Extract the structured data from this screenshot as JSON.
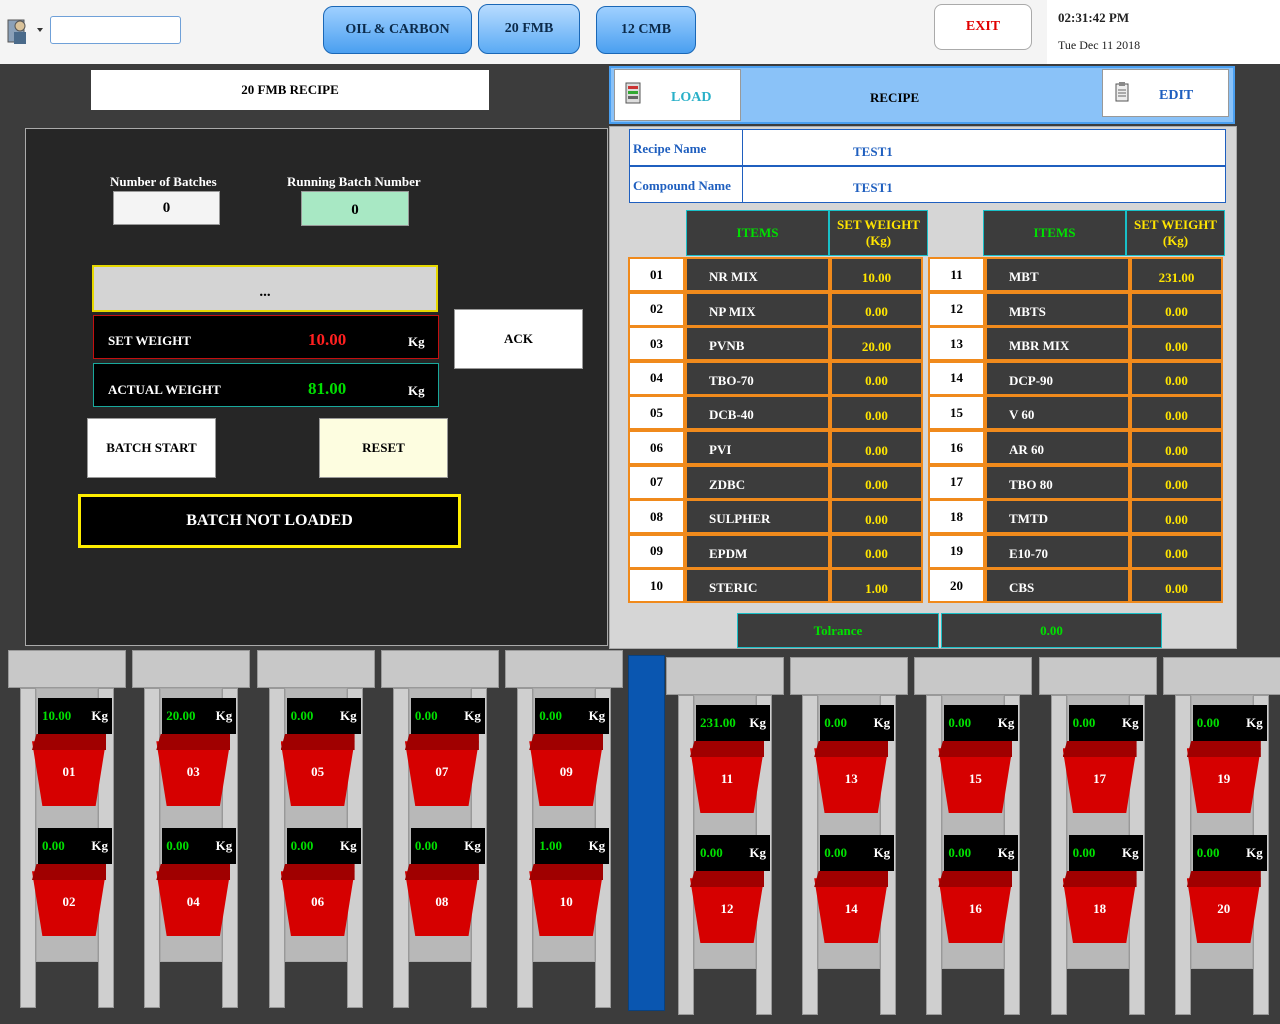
{
  "header": {
    "tabs": [
      {
        "label": "OIL & CARBON"
      },
      {
        "label": "20 FMB"
      },
      {
        "label": "12 CMB"
      }
    ],
    "exit_label": "EXIT",
    "time": "02:31:42 PM",
    "date": "Tue Dec 11 2018",
    "search_value": ""
  },
  "left": {
    "title": "20 FMB RECIPE",
    "batches_label": "Number of Batches",
    "batches_value": "0",
    "running_label": "Running Batch Number",
    "running_value": "0",
    "item_display": "...",
    "set_weight_label": "SET WEIGHT",
    "set_weight_value": "10.00",
    "actual_weight_label": "ACTUAL WEIGHT",
    "actual_weight_value": "81.00",
    "unit": "Kg",
    "ack_label": "ACK",
    "batch_start_label": "BATCH START",
    "reset_label": "RESET",
    "status": "BATCH NOT LOADED"
  },
  "recipe": {
    "load_label": "LOAD",
    "title": "RECIPE",
    "edit_label": "EDIT",
    "recipe_name_label": "Recipe Name",
    "recipe_name": "TEST1",
    "compound_name_label": "Compound Name",
    "compound_name": "TEST1",
    "items_header": "ITEMS",
    "setweight_header": "SET WEIGHT (Kg)",
    "rows_left": [
      {
        "no": "01",
        "item": "NR MIX",
        "weight": "10.00"
      },
      {
        "no": "02",
        "item": "NP MIX",
        "weight": "0.00"
      },
      {
        "no": "03",
        "item": "PVNB",
        "weight": "20.00"
      },
      {
        "no": "04",
        "item": "TBO-70",
        "weight": "0.00"
      },
      {
        "no": "05",
        "item": "DCB-40",
        "weight": "0.00"
      },
      {
        "no": "06",
        "item": "PVI",
        "weight": "0.00"
      },
      {
        "no": "07",
        "item": "ZDBC",
        "weight": "0.00"
      },
      {
        "no": "08",
        "item": "SULPHER",
        "weight": "0.00"
      },
      {
        "no": "09",
        "item": "EPDM",
        "weight": "0.00"
      },
      {
        "no": "10",
        "item": "STERIC",
        "weight": "1.00"
      }
    ],
    "rows_right": [
      {
        "no": "11",
        "item": "MBT",
        "weight": "231.00"
      },
      {
        "no": "12",
        "item": "MBTS",
        "weight": "0.00"
      },
      {
        "no": "13",
        "item": "MBR MIX",
        "weight": "0.00"
      },
      {
        "no": "14",
        "item": "DCP-90",
        "weight": "0.00"
      },
      {
        "no": "15",
        "item": "V 60",
        "weight": "0.00"
      },
      {
        "no": "16",
        "item": "AR 60",
        "weight": "0.00"
      },
      {
        "no": "17",
        "item": "TBO 80",
        "weight": "0.00"
      },
      {
        "no": "18",
        "item": "TMTD",
        "weight": "0.00"
      },
      {
        "no": "19",
        "item": "E10-70",
        "weight": "0.00"
      },
      {
        "no": "20",
        "item": "CBS",
        "weight": "0.00"
      }
    ],
    "tolerance_label": "Tolrance",
    "tolerance_value": "0.00"
  },
  "hoppers": {
    "unit": "Kg",
    "left_columns": [
      {
        "top": {
          "id": "01",
          "weight": "10.00"
        },
        "bottom": {
          "id": "02",
          "weight": "0.00"
        }
      },
      {
        "top": {
          "id": "03",
          "weight": "20.00"
        },
        "bottom": {
          "id": "04",
          "weight": "0.00"
        }
      },
      {
        "top": {
          "id": "05",
          "weight": "0.00"
        },
        "bottom": {
          "id": "06",
          "weight": "0.00"
        }
      },
      {
        "top": {
          "id": "07",
          "weight": "0.00"
        },
        "bottom": {
          "id": "08",
          "weight": "0.00"
        }
      },
      {
        "top": {
          "id": "09",
          "weight": "0.00"
        },
        "bottom": {
          "id": "10",
          "weight": "1.00"
        }
      }
    ],
    "right_columns": [
      {
        "top": {
          "id": "11",
          "weight": "231.00"
        },
        "bottom": {
          "id": "12",
          "weight": "0.00"
        }
      },
      {
        "top": {
          "id": "13",
          "weight": "0.00"
        },
        "bottom": {
          "id": "14",
          "weight": "0.00"
        }
      },
      {
        "top": {
          "id": "15",
          "weight": "0.00"
        },
        "bottom": {
          "id": "16",
          "weight": "0.00"
        }
      },
      {
        "top": {
          "id": "17",
          "weight": "0.00"
        },
        "bottom": {
          "id": "18",
          "weight": "0.00"
        }
      },
      {
        "top": {
          "id": "19",
          "weight": "0.00"
        },
        "bottom": {
          "id": "20",
          "weight": "0.00"
        }
      }
    ]
  },
  "colors": {
    "accent_blue": "#4a9ff0",
    "table_border": "#f08a1c",
    "value_yellow": "#ffe400",
    "value_green": "#00e000",
    "set_weight_red": "#ff2020",
    "hopper_red": "#d60000"
  }
}
